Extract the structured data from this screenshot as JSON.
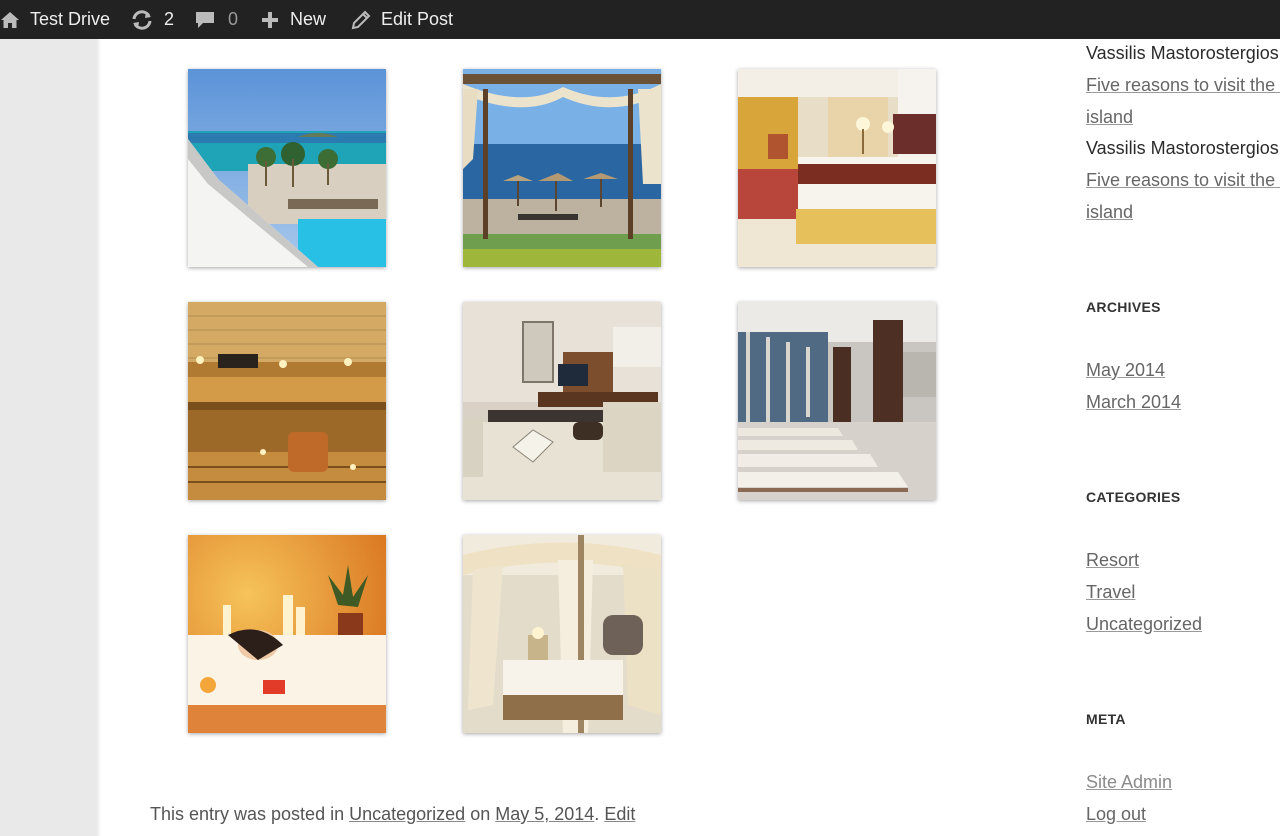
{
  "adminbar": {
    "site_name": "Test Drive",
    "updates_count": "2",
    "comments_count": "0",
    "new_label": "New",
    "edit_post_label": "Edit Post"
  },
  "gallery": {
    "images": [
      {
        "alt": "Resort pool with sea view"
      },
      {
        "alt": "Beach with umbrellas under canopy"
      },
      {
        "alt": "Hotel bedroom"
      },
      {
        "alt": "Wooden sauna with candles"
      },
      {
        "alt": "Living room lounge"
      },
      {
        "alt": "Spa pool loungers"
      },
      {
        "alt": "Woman relaxing in bubble bath"
      },
      {
        "alt": "Canopy bed bedroom"
      }
    ]
  },
  "entry_meta": {
    "prefix": "This entry was posted in",
    "category": "Uncategorized",
    "on": "on",
    "date": "May 5, 2014",
    "edit": "Edit"
  },
  "sidebar": {
    "recent_comments": [
      {
        "author": "Vassilis Mastorostergios",
        "post_line1": "Five reasons to visit the l",
        "post_line2": "island"
      },
      {
        "author": "Vassilis Mastorostergios",
        "post_line1": "Five reasons to visit the l",
        "post_line2": "island"
      }
    ],
    "archives": {
      "heading": "ARCHIVES",
      "items": [
        "May 2014",
        "March 2014"
      ]
    },
    "categories": {
      "heading": "CATEGORIES",
      "items": [
        "Resort",
        "Travel",
        "Uncategorized"
      ]
    },
    "meta": {
      "heading": "META",
      "items": [
        "Site Admin",
        "Log out"
      ]
    }
  }
}
